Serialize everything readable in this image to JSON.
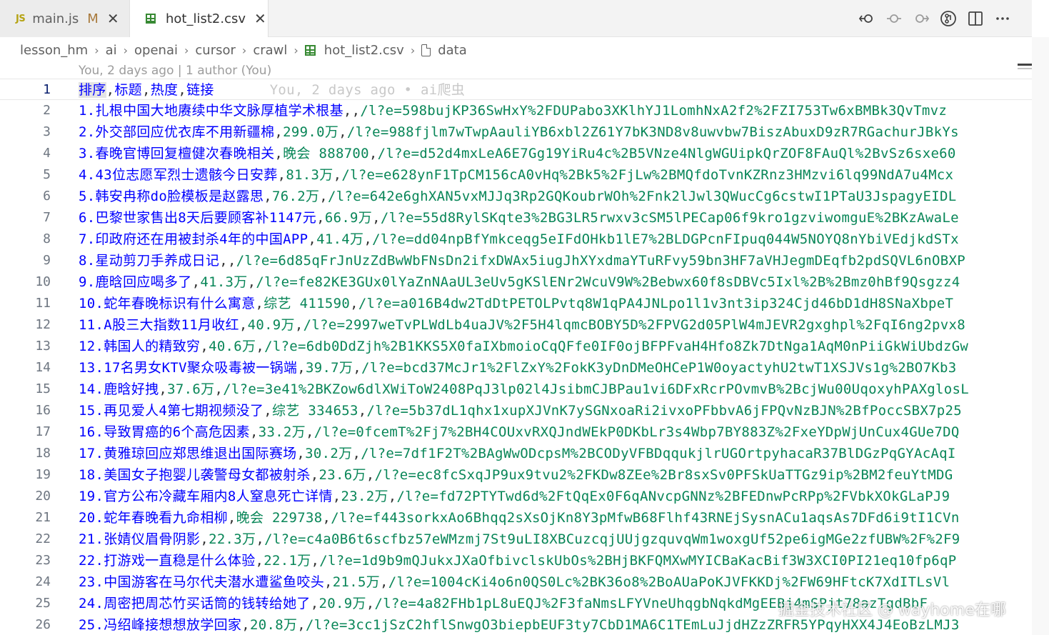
{
  "tabs": [
    {
      "icon": "JS",
      "label": "main.js",
      "badge": "M",
      "active": false
    },
    {
      "icon": "csv-icon",
      "label": "hot_list2.csv",
      "active": true
    }
  ],
  "actions": [
    "toggle-changes-icon",
    "previous-change-icon",
    "next-change-icon",
    "open-changes-icon",
    "split-editor-icon",
    "more-actions-icon"
  ],
  "breadcrumb": [
    "lesson_hm",
    "ai",
    "openai",
    "cursor",
    "crawl",
    "hot_list2.csv",
    "data"
  ],
  "blame_header": "You, 2 days ago | 1 author (You)",
  "inline_blame": "You, 2 days ago • ai爬虫",
  "header_fields": [
    "排序",
    "标题",
    "热度",
    "链接"
  ],
  "rows": [
    {
      "rank": "1.",
      "title": "扎根中国大地赓续中华文脉厚植学术根基",
      "heat": "",
      "link": "/l?e=598bujKP36SwHxY%2FDUPabo3XKlhYJ1LomhNxA2f2%2FZI753Tw6xBMBk3QvTmvz"
    },
    {
      "rank": "2.",
      "title": "外交部回应优衣库不用新疆棉",
      "heat": "299.0万",
      "link": "/l?e=988fjlm7wTwpAauliYB6xbl2Z61Y7bK3ND8v8uwvbw7BiszAbuxD9zR7RGachurJBkYs"
    },
    {
      "rank": "3.",
      "title": "春晚官博回复檀健次春晚相关",
      "heat": "晚会 888700",
      "link": "/l?e=d52d4mxLeA6E7Gg19YiRu4c%2B5VNze4NlgWGUipkQrZOF8FAuQl%2BvSz6sxe60"
    },
    {
      "rank": "4.",
      "title": "43位志愿军烈士遗骸今日安葬",
      "heat": "81.3万",
      "link": "/l?e=e628ynF1TpCM156cA0vHq%2Bk5%2FjLw%2BMQfdoTvnKZRnz3HMzvi6lq99NdA7u4Mcx"
    },
    {
      "rank": "5.",
      "title": "韩安冉称do脸模板是赵露思",
      "heat": "76.2万",
      "link": "/l?e=642e6ghXAN5vxMJJq3Rp2GQKoubrWOh%2Fnk2lJwl3QWucCg6cstwI1PTaU3JspagyEIDL"
    },
    {
      "rank": "6.",
      "title": "巴黎世家售出8天后要顾客补1147元",
      "heat": "66.9万",
      "link": "/l?e=55d8RylSKqte3%2BG3LR5rwxv3cSM5lPECap06f9kro1gzviwomguE%2BKzAwaLe"
    },
    {
      "rank": "7.",
      "title": "印政府还在用被封杀4年的中国APP",
      "heat": "41.4万",
      "link": "/l?e=dd04npBfYmkceqg5eIFdOHkb1lE7%2BLDGPcnFIpuq044W5NOYQ8nYbiVEdjkdSTx"
    },
    {
      "rank": "8.",
      "title": "星动剪刀手养成日记",
      "heat": "",
      "link": "/l?e=6d85qFrJnUzZdBwWbFNsDn2ifxDWAx5iugJhXYxdmaYTuRFvy59bn3HF7aVHJegmDEqfb2pdSQVL6nOBXP"
    },
    {
      "rank": "9.",
      "title": "鹿晗回应喝多了",
      "heat": "41.3万",
      "link": "/l?e=fe82KE3GUx0lYaZnNAaUL3eUv5gKSlENr2WcuV9W%2Bebwx60f8sDBVc5Ixl%2B%2Bmz0hBf9Qsgzz4"
    },
    {
      "rank": "10.",
      "title": "蛇年春晚标识有什么寓意",
      "heat": "综艺 411590",
      "link": "/l?e=a016B4dw2TdDtPETOLPvtq8W1qPA4JNLpo1l1v3nt3ip324Cjd46bD1dH8SNaXbpeT"
    },
    {
      "rank": "11.",
      "title": "A股三大指数11月收红",
      "heat": "40.9万",
      "link": "/l?e=2997weTvPLWdLb4uaJV%2F5H4lqmcBOBY5D%2FPVG2d05PlW4mJEVR2gxghpl%2FqI6ng2pvx8"
    },
    {
      "rank": "12.",
      "title": "韩国人的精致穷",
      "heat": "40.6万",
      "link": "/l?e=6db0DdZjh%2B1KKS5X0faIXbmoioCqQFfe0IF0ojBFPFvaH4Hfo8Zk7DtNga1AqM0nPiiGkWiUbdzGw"
    },
    {
      "rank": "13.",
      "title": "17名男女KTV聚众吸毒被一锅端",
      "heat": "39.7万",
      "link": "/l?e=bcd37McJr1%2FlZxY%2FokK3yDnDMeOHCeP1W0oyactyhU2twT1XSJVs1g%2BO7Kb3"
    },
    {
      "rank": "14.",
      "title": "鹿晗好拽",
      "heat": "37.6万",
      "link": "/l?e=3e41%2BKZow6dlXWiToW2408PqJ3lp02l4JsibmCJBPau1vi6DFxRcrPOvmvB%2BcjWu00UqoxyhPAXglosL"
    },
    {
      "rank": "15.",
      "title": "再见爱人4第七期视频没了",
      "heat": "综艺 334653",
      "link": "/l?e=5b37dL1qhx1xupXJVnK7ySGNxoaRi2ivxoPFbbvA6jFPQvNzBJN%2BfPoccSBX7p25"
    },
    {
      "rank": "16.",
      "title": "导致胃癌的6个高危因素",
      "heat": "33.2万",
      "link": "/l?e=0fcemT%2Fj7%2BH4COUxvRXQJndWEkP0DKbLr3s4Wbp7BY883Z%2FxeYDpWjUnCux4GUe7DQ"
    },
    {
      "rank": "17.",
      "title": "黄雅琼回应郑思维退出国际赛场",
      "heat": "30.2万",
      "link": "/l?e=7df1F2T%2BAgWwODcpsM%2BCODyVFBDqqukjlrUGOrtpyhacaR37BlDGzPqGYAcAqI"
    },
    {
      "rank": "18.",
      "title": "美国女子抱婴儿袭警母女都被射杀",
      "heat": "23.6万",
      "link": "/l?e=ec8fcSxqJP9ux9tvu2%2FKDw8ZEe%2Br8sxSv0PFSkUaTTGz9ip%2BM2feuYtMDG"
    },
    {
      "rank": "19.",
      "title": "官方公布冷藏车厢内8人窒息死亡详情",
      "heat": "23.2万",
      "link": "/l?e=fd72PTYTwd6d%2FtQqEx0F6qANvcpGNNz%2BFEDnwPcRPp%2FVbkXOkGLaPJ9"
    },
    {
      "rank": "20.",
      "title": "蛇年春晚看九命相柳",
      "heat": "晚会 229738",
      "link": "/l?e=f443sorkxAo6Bhqq2sXsOjKn8Y3pMfwB68Flhf43RNEjSysnACu1aqsAs7DFd6i9tI1CVn"
    },
    {
      "rank": "21.",
      "title": "张婧仪眉骨阴影",
      "heat": "22.3万",
      "link": "/l?e=c4a0B6t6scfbz57eWMzmj7St9uLI8XBCuzcqjUUjgzquvqWm1woxgUf52pe6igMGe2zfUBW%2F%2F9"
    },
    {
      "rank": "22.",
      "title": "打游戏一直稳是什么体验",
      "heat": "22.1万",
      "link": "/l?e=1d9b9mQJukxJXaOfbivclskUbOs%2BHjBKFQMXwMYICBaKacBif3W3XCI0PI21eq10fp6qP"
    },
    {
      "rank": "23.",
      "title": "中国游客在马尔代夫潜水遭鲨鱼咬头",
      "heat": "21.5万",
      "link": "/l?e=1004cKi4o6n0QS0Lc%2BK36o8%2BoAUaPoKJVFKKDj%2FW69HFtcK7XdITLsVl"
    },
    {
      "rank": "24.",
      "title": "周密把周芯竹买话筒的钱转给她了",
      "heat": "20.9万",
      "link": "/l?e=4a82FHb1pL8uEQJ%2F3faNmsLFYVneUhqgbNqkdMgEEBj4mSPjt78azTgdBbF"
    },
    {
      "rank": "25.",
      "title": "冯绍峰接想想放学回家",
      "heat": "20.8万",
      "link": "/l?e=3cc1jSzC2hflSnwgO3biepbEUF3ty7CbD1MA6C1TEmLuJjdHZzZRFR5YPqyHXX4J4EoBzLMJ3"
    }
  ],
  "watermark": "掘金技术社区 @ wayhome在哪",
  "colors": {
    "rank_title": "#0000ff",
    "heat_link": "#098658",
    "modified_badge": "#a8793b",
    "csv_icon": "#388a34"
  }
}
